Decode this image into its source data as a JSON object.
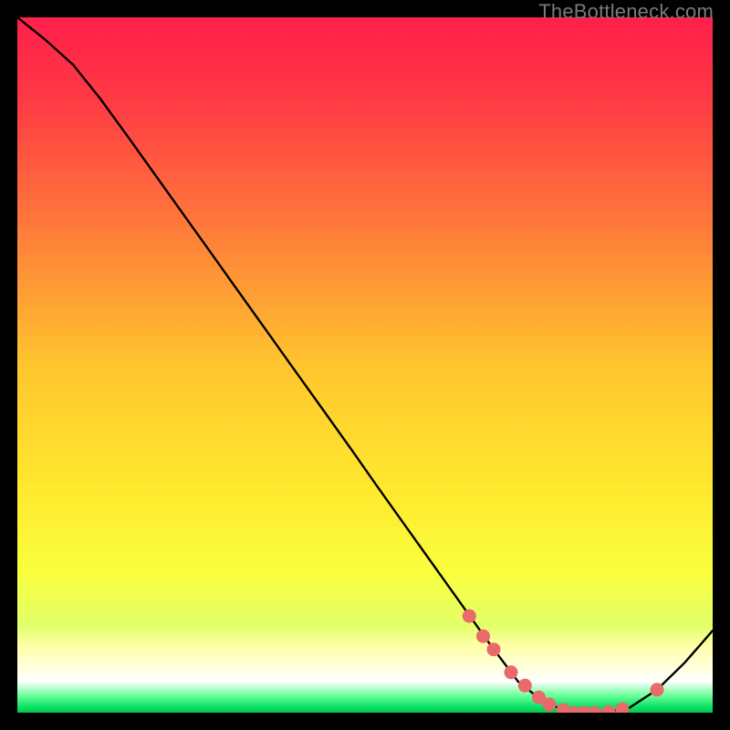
{
  "watermark": "TheBottleneck.com",
  "chart_data": {
    "type": "line",
    "title": "",
    "xlabel": "",
    "ylabel": "",
    "xlim": [
      0,
      100
    ],
    "ylim": [
      0,
      100
    ],
    "grid": false,
    "series": [
      {
        "name": "bottleneck-curve",
        "x": [
          0,
          4,
          8,
          12,
          16,
          20,
          24,
          28,
          32,
          36,
          40,
          44,
          48,
          52,
          56,
          60,
          64,
          68,
          72,
          76,
          80,
          84,
          88,
          92,
          96,
          100
        ],
        "y": [
          100,
          96.8,
          93.2,
          88.2,
          82.7,
          77.1,
          71.5,
          65.9,
          60.3,
          54.7,
          49.1,
          43.5,
          37.9,
          32.2,
          26.6,
          21.0,
          15.4,
          9.8,
          4.5,
          1.3,
          0.0,
          0.0,
          0.7,
          3.3,
          7.2,
          11.8
        ]
      }
    ],
    "markers": {
      "name": "highlight-dots",
      "color": "#e86a6a",
      "x": [
        65.0,
        67.0,
        68.5,
        71.0,
        73.0,
        75.0,
        76.5,
        78.5,
        80.0,
        81.5,
        83.0,
        85.0,
        87.0,
        92.0
      ],
      "y": [
        13.9,
        11.0,
        9.1,
        5.8,
        3.9,
        2.2,
        1.2,
        0.4,
        0.0,
        0.0,
        0.0,
        0.1,
        0.5,
        3.3
      ]
    },
    "gradient_stops": [
      {
        "offset": 0.0,
        "color": "#ff1f4b"
      },
      {
        "offset": 0.12,
        "color": "#ff3a44"
      },
      {
        "offset": 0.3,
        "color": "#ff7a3a"
      },
      {
        "offset": 0.5,
        "color": "#ffc52e"
      },
      {
        "offset": 0.68,
        "color": "#ffe92e"
      },
      {
        "offset": 0.8,
        "color": "#f9ff3e"
      },
      {
        "offset": 0.875,
        "color": "#e3ff6a"
      },
      {
        "offset": 0.905,
        "color": "#ffffa8"
      },
      {
        "offset": 0.955,
        "color": "#ffffff"
      },
      {
        "offset": 0.975,
        "color": "#6fff9c"
      },
      {
        "offset": 0.99,
        "color": "#12e66a"
      },
      {
        "offset": 1.0,
        "color": "#00c74f"
      }
    ]
  }
}
